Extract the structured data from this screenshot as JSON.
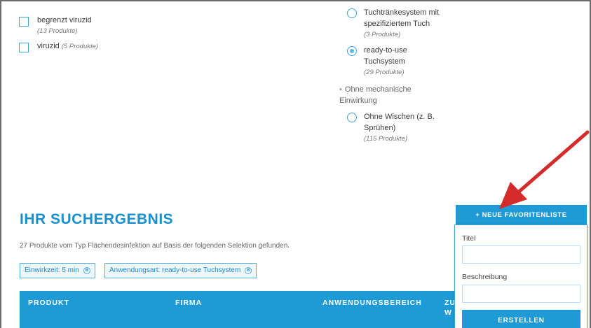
{
  "filters_left": [
    {
      "label": "begrenzt viruzid",
      "count": "(13 Produkte)"
    },
    {
      "label": "viruzid",
      "count": "(5 Produkte)"
    }
  ],
  "filters_right": {
    "radio_top": {
      "label": "Tuchtränkesystem mit spezifiziertem Tuch",
      "count": "(3 Produkte)"
    },
    "radio_selected": {
      "label": "ready-to-use Tuchsystem",
      "count": "(29 Produkte)"
    },
    "group_label": "Ohne mechanische Einwirkung",
    "radio_bottom": {
      "label": "Ohne Wischen (z. B. Sprühen)",
      "count": "(115 Produkte)"
    }
  },
  "results": {
    "title": "IHR SUCHERGEBNIS",
    "description": "27 Produkte vom Typ Flächendesinfektion auf Basis der folgenden Selektion gefunden.",
    "chips": [
      "Einwirkzeit: 5 min",
      "Anwendungsart: ready-to-use Tuchsystem"
    ],
    "chip_remove_icon": "⊗"
  },
  "table": {
    "headers": [
      "PRODUKT",
      "FIRMA",
      "ANWENDUNGSBEREICH",
      "ZU",
      "W"
    ]
  },
  "favorites": {
    "new_button": "+ NEUE FAVORITENLISTE",
    "title_label": "Titel",
    "description_label": "Beschreibung",
    "create_button": "ERSTELLEN"
  },
  "colors": {
    "accent": "#1e9ad6",
    "arrow": "#d42b2b"
  },
  "annotation": {
    "icon": "red-arrow-icon"
  }
}
